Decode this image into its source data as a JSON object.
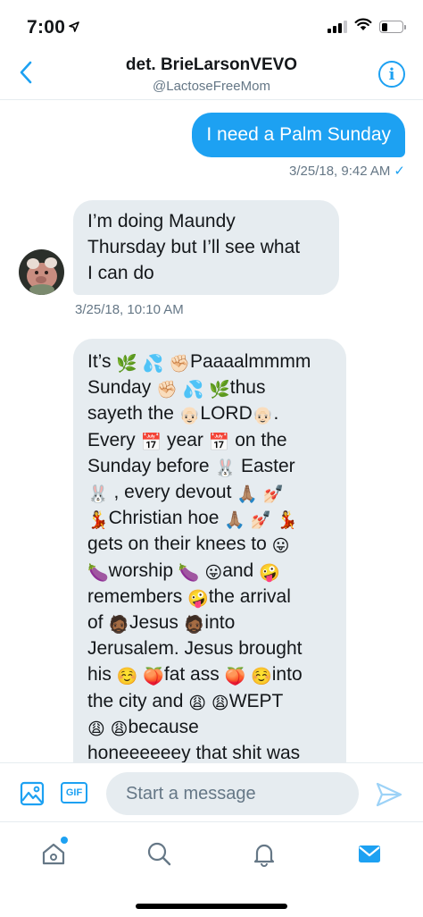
{
  "status": {
    "time": "7:00",
    "battery_level": 0.3
  },
  "header": {
    "title": "det. BrieLarsonVEVO",
    "handle": "@LactoseFreeMom"
  },
  "messages": {
    "outgoing": {
      "text": "I need a Palm Sunday",
      "timestamp": "3/25/18, 9:42 AM",
      "status_icon": "check-icon"
    },
    "incoming_1": {
      "lines": [
        "I’m doing Maundy",
        "Thursday but I’ll see what",
        "I can do"
      ],
      "timestamp": "3/25/18, 10:10 AM"
    },
    "incoming_2": {
      "lines": [
        [
          "It’s ",
          "🌿",
          " ",
          "💦",
          " ",
          "✊🏻",
          "Paaaalmmmm"
        ],
        [
          "Sunday ",
          "✊🏻",
          " ",
          "💦",
          " ",
          "🌿",
          "thus"
        ],
        [
          "sayeth the ",
          "👴🏻",
          "LORD",
          "👴🏻",
          "."
        ],
        [
          "Every ",
          "📅",
          " year ",
          "📅",
          " on the"
        ],
        [
          "Sunday before ",
          "🐰",
          " Easter"
        ],
        [
          "🐰",
          " , every devout ",
          "🙏🏽",
          " ",
          "💅🏻"
        ],
        [
          "💃",
          "Christian hoe ",
          "🙏🏽",
          " ",
          "💅🏻",
          " ",
          "💃"
        ],
        [
          "gets on their knees to ",
          "😛"
        ],
        [
          "🍆",
          "worship ",
          "🍆",
          " ",
          "😛",
          "and ",
          "🤪"
        ],
        [
          "remembers ",
          "🤪",
          "the arrival"
        ],
        [
          "of ",
          "🧔🏾",
          "Jesus ",
          "🧔🏾",
          "into"
        ],
        [
          "Jerusalem. Jesus brought"
        ],
        [
          "his ",
          "☺️",
          " ",
          "🍑",
          "fat ass ",
          "🍑",
          " ",
          "☺️",
          "into"
        ],
        [
          "the city and ",
          "😩",
          " ",
          "😩",
          "WEPT"
        ],
        [
          "😩",
          " ",
          "😩",
          "because"
        ],
        [
          "honeeeeeey that shit was"
        ]
      ]
    }
  },
  "composer": {
    "placeholder": "Start a message",
    "gif_label": "GIF"
  },
  "colors": {
    "accent": "#1da1f2",
    "bubble_in": "#e6ecf0",
    "muted": "#657786"
  },
  "tabs": [
    "home-icon",
    "search-icon",
    "notifications-icon",
    "messages-icon"
  ]
}
